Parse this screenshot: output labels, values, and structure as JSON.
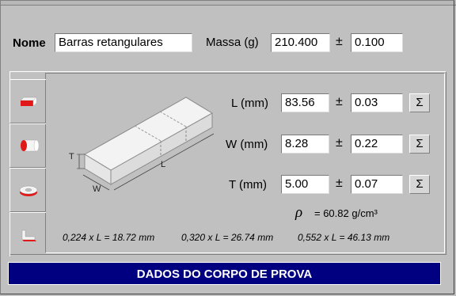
{
  "nome": {
    "label": "Nome",
    "value": "Barras retangulares"
  },
  "massa": {
    "label": "Massa (g)",
    "value": "210.400",
    "pm": "±",
    "uncertainty": "0.100"
  },
  "tabs": [
    {
      "icon": "bar-shape-icon"
    },
    {
      "icon": "cylinder-shape-icon"
    },
    {
      "icon": "ring-shape-icon"
    },
    {
      "icon": "angle-shape-icon"
    }
  ],
  "diagram": {
    "T": "T",
    "W": "W",
    "L": "L"
  },
  "dims": [
    {
      "label": "L (mm)",
      "value": "83.56",
      "pm": "±",
      "uncertainty": "0.03",
      "sigma": "Σ"
    },
    {
      "label": "W (mm)",
      "value": "8.28",
      "pm": "±",
      "uncertainty": "0.22",
      "sigma": "Σ"
    },
    {
      "label": "T (mm)",
      "value": "5.00",
      "pm": "±",
      "uncertainty": "0.07",
      "sigma": "Σ"
    }
  ],
  "density": {
    "symbol": "ρ",
    "text": "= 60.82 g/cm³"
  },
  "formulas": [
    "0,224 x L = 18.72 mm",
    "0,320 x L = 26.74 mm",
    "0,552 x L = 46.13 mm"
  ],
  "banner": "DADOS DO CORPO DE PROVA"
}
